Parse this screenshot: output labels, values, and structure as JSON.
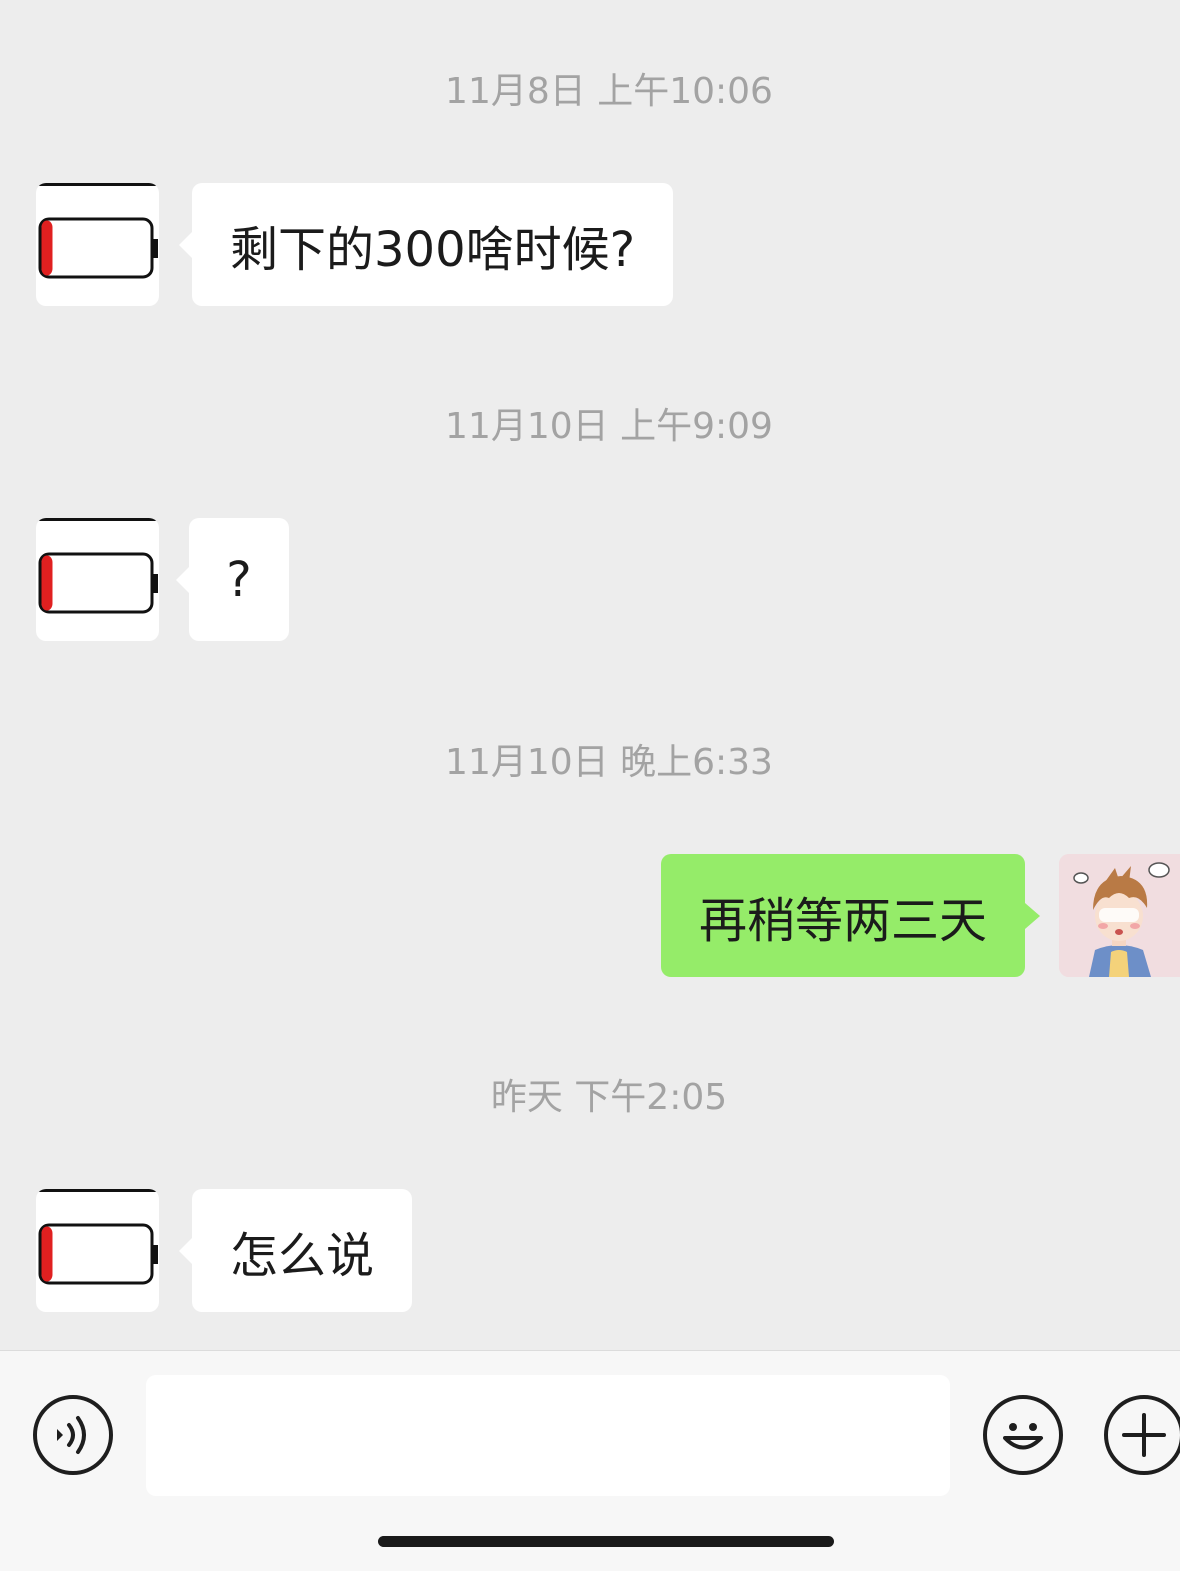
{
  "messages": [
    {
      "timestamp": "11月8日 上午10:06",
      "direction": "incoming",
      "text": "剩下的300啥时候?"
    },
    {
      "timestamp": "11月10日 上午9:09",
      "direction": "incoming",
      "text": "?"
    },
    {
      "timestamp": "11月10日 晚上6:33",
      "direction": "outgoing",
      "text": "再稍等两三天"
    },
    {
      "timestamp": "昨天 下午2:05",
      "direction": "incoming",
      "text": "怎么说"
    }
  ],
  "contact_avatar": {
    "icon": "low-battery-icon",
    "battery_color": "#e02020"
  },
  "self_avatar": {
    "icon": "cartoon-boy-avatar"
  },
  "input_bar": {
    "voice_icon": "voice-icon",
    "text_value": "",
    "emoji_icon": "emoji-icon",
    "plus_icon": "plus-icon"
  },
  "colors": {
    "background": "#ededed",
    "incoming_bubble": "#ffffff",
    "outgoing_bubble": "#95ec69",
    "timestamp_text": "#a3a3a3"
  }
}
